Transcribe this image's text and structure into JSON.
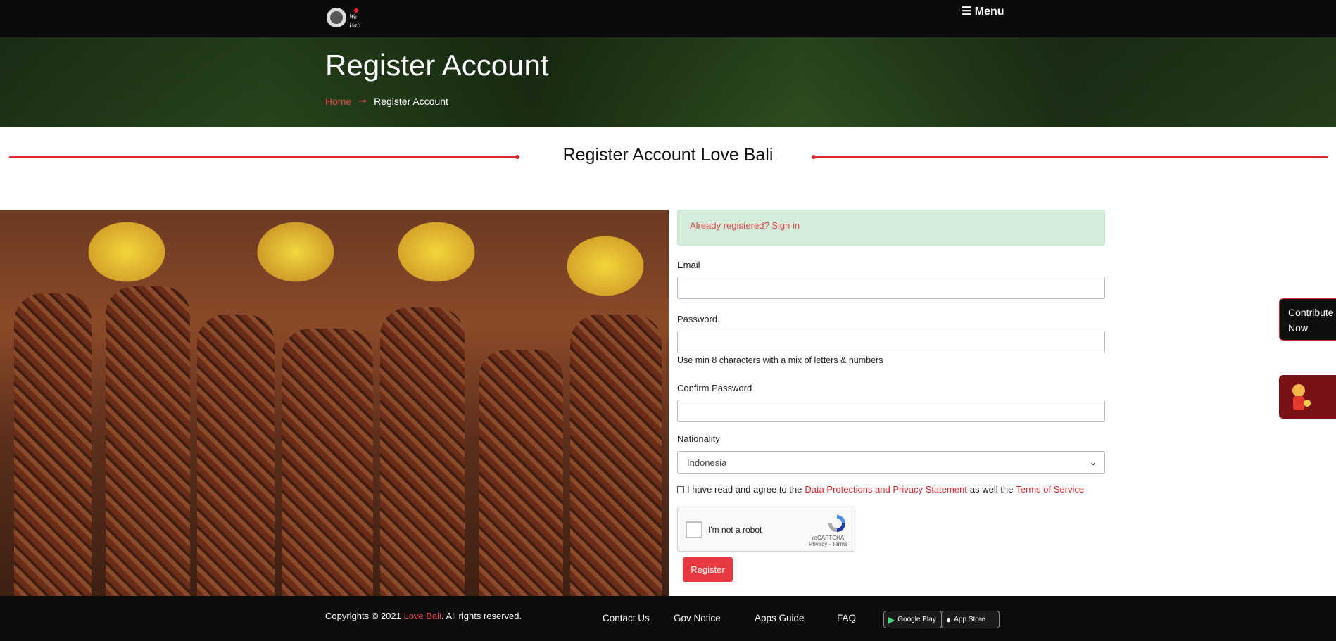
{
  "header": {
    "logo_alt": "We Love Bali",
    "menu_label": "☰ Menu"
  },
  "hero": {
    "title": "Register Account",
    "breadcrumb": {
      "home": "Home",
      "separator": "➞",
      "current": "Register Account"
    }
  },
  "section": {
    "title": "Register Account Love Bali"
  },
  "form": {
    "signin_link": "Already registered? Sign in",
    "email_label": "Email",
    "password_label": "Password",
    "password_hint": "Use min 8 characters with a mix of letters & numbers",
    "confirm_label": "Confirm Password",
    "nationality_label": "Nationality",
    "nationality_value": "Indonesia",
    "agree_prefix": "I have read and agree to the",
    "agree_link1": "Data Protections and Privacy Statement",
    "agree_middle": "as well the",
    "agree_link2": "Terms of Service",
    "captcha_text": "I'm not a robot",
    "captcha_brand": "reCAPTCHA",
    "captcha_sub": "Privacy - Terms",
    "register_button": "Register"
  },
  "side": {
    "contribute": "Contribute Now"
  },
  "footer": {
    "copy_prefix": "Copyrights © 2021",
    "copy_brand": "Love Bali",
    "copy_suffix": ". All rights reserved.",
    "links": [
      "Contact Us",
      "Gov Notice",
      "Apps Guide",
      "FAQ"
    ],
    "google_play": "Google Play",
    "app_store": "App Store"
  },
  "colors": {
    "accent": "#d9272e",
    "success_bg": "#d4edda",
    "dark": "#0b0b0b"
  }
}
